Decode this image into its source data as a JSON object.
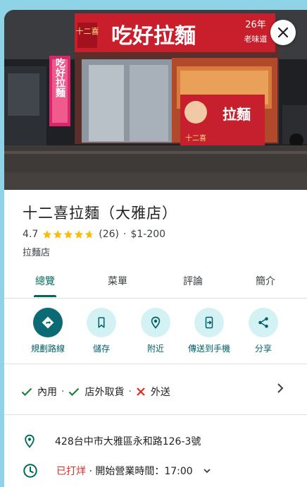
{
  "place": {
    "name": "十二喜拉麵（大雅店）",
    "rating": "4.7",
    "stars": 4.7,
    "review_count": "(26)",
    "separator": "·",
    "price": "$1-200",
    "category": "拉麵店"
  },
  "photo": {
    "sign_main": "吃好拉麵",
    "sign_badge": "十二喜",
    "sign_side_1": "26年",
    "sign_side_2": "老味道",
    "vertical_sign": "吃好拉麵",
    "side_banner": "拉麵",
    "side_banner_brand": "十二喜"
  },
  "tabs": [
    "總覽",
    "菜單",
    "評論",
    "簡介"
  ],
  "actions": [
    {
      "label": "規劃路線",
      "icon": "directions-icon"
    },
    {
      "label": "儲存",
      "icon": "bookmark-icon"
    },
    {
      "label": "附近",
      "icon": "nearby-icon"
    },
    {
      "label": "傳送到手機",
      "icon": "send-to-phone-icon"
    },
    {
      "label": "分享",
      "icon": "share-icon"
    }
  ],
  "services": {
    "dine_in": "內用",
    "takeout": "店外取貨",
    "delivery": "外送",
    "separator": "·"
  },
  "address": "428台中市大雅區永和路126-3號",
  "hours": {
    "status": "已打烊",
    "separator": "·",
    "next": "開始營業時間：17:00"
  },
  "colors": {
    "accent": "#00695c",
    "action_bg": "#d4f1f4",
    "primary_action": "#0b6a74",
    "star": "#fbbc04",
    "closed": "#d93025",
    "check": "#188038",
    "cross": "#d93025"
  }
}
